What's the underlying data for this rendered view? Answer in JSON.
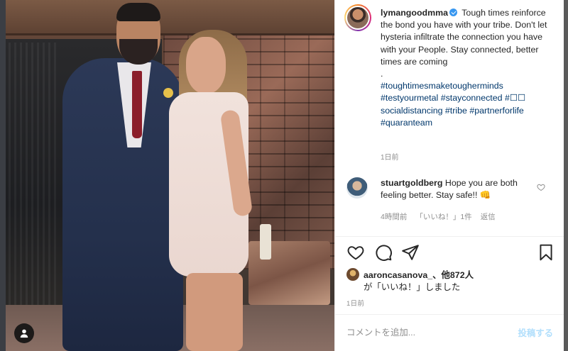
{
  "photo": {
    "alt_tag_icon": "user-icon"
  },
  "post": {
    "author": "lymangoodmma",
    "caption_text": "Tough times reinforce the bond you have with your tribe. Don't let hysteria infiltrate the connection you have with your People. Stay connected, better times are coming",
    "caption_dot": ".",
    "hashtags": "#toughtimesmaketougherminds #testyourmetal #stayconnected #☐☐ socialdistancing #tribe #partnerforlife #quaranteam",
    "time": "1日前"
  },
  "comment": {
    "user": "stuartgoldberg",
    "text": "Hope you are both feeling better. Stay safe!! 👊",
    "time": "4時間前",
    "likes_label": "「いいね！」1件",
    "reply_label": "返信"
  },
  "likes": {
    "user": "aaroncasanova_",
    "others": "、他872人",
    "suffix": "が「いいね！」しました"
  },
  "date": "1日前",
  "add_comment": {
    "placeholder": "コメントを追加...",
    "post_label": "投稿する"
  },
  "colors": {
    "link": "#00376b",
    "verified": "#3897f0",
    "post_button_disabled": "#b2dffc",
    "muted": "#8e8e8e"
  }
}
